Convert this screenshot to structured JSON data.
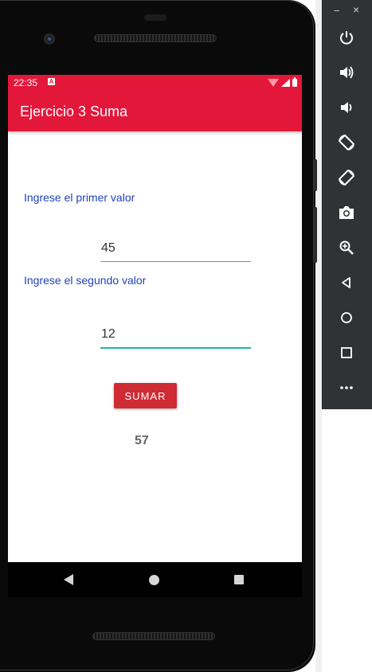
{
  "status_bar": {
    "time": "22:35",
    "notification_icon": "A"
  },
  "app_bar": {
    "title": "Ejercicio 3 Suma"
  },
  "form": {
    "first_label": "Ingrese el primer valor",
    "first_value": "45",
    "second_label": "Ingrese el segundo valor",
    "second_value": "12",
    "button_label": "SUMAR",
    "result": "57"
  },
  "colors": {
    "app_bar": "#e3173a",
    "label": "#2142b8",
    "button": "#cf2b35",
    "focus_underline": "#18b8a8"
  },
  "emulator_toolbar": {
    "window_controls": {
      "minimize": "−",
      "close": "×"
    },
    "buttons": [
      "power-icon",
      "volume-up-icon",
      "volume-down-icon",
      "rotate-left-icon",
      "rotate-right-icon",
      "camera-icon",
      "zoom-icon",
      "back-icon",
      "home-icon",
      "overview-icon",
      "more-icon"
    ]
  },
  "nav_bar": {
    "buttons": [
      "back-icon",
      "home-icon",
      "recent-apps-icon"
    ]
  }
}
